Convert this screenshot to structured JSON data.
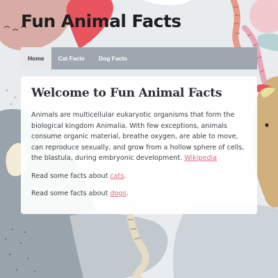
{
  "site": {
    "title": "Fun Animal Facts"
  },
  "nav": {
    "items": [
      {
        "label": "Home"
      },
      {
        "label": "Cat Facts"
      },
      {
        "label": "Dog Facts"
      }
    ]
  },
  "main": {
    "heading": "Welcome to Fun Animal Facts",
    "intro": "Animals are multicellular eukaryotic organisms that form the biological kingdom Animalia. With few exceptions, animals consume organic material, breathe oxygen, are able to move, can reproduce sexually, and grow from a hollow sphere of cells, the blastula, during embryonic development. ",
    "intro_link": "Wikipedia",
    "cats_text": "Read some facts about ",
    "cats_link": "cats",
    "dogs_text": "Read some facts about ",
    "dogs_link": "dogs",
    "period": "."
  },
  "colors": {
    "link": "#e4667d",
    "nav_bg": "#9ea7af",
    "nav_active_bg": "#e6e8ea",
    "page_bg": "#e9ecee"
  }
}
